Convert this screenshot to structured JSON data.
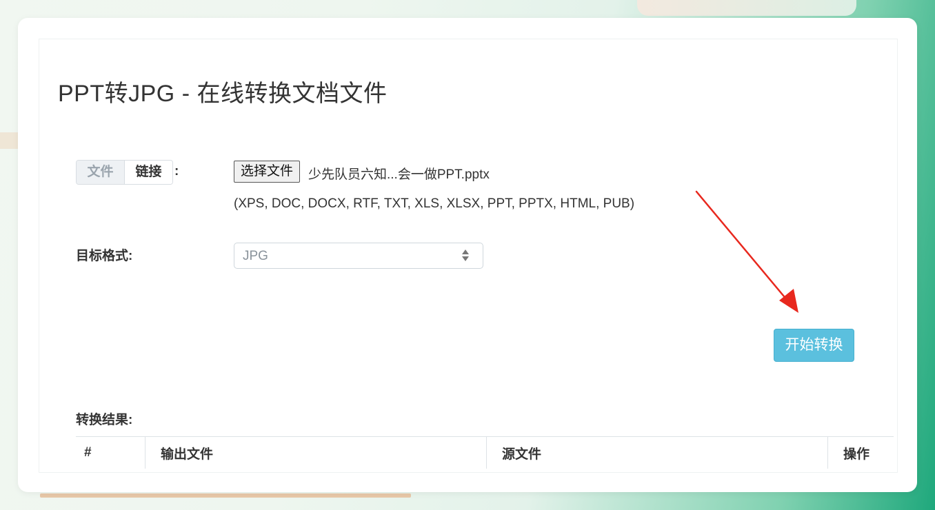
{
  "page": {
    "title": "PPT转JPG - 在线转换文档文件"
  },
  "source": {
    "tabs": [
      {
        "label": "文件",
        "active": true
      },
      {
        "label": "链接",
        "active": false
      }
    ],
    "colon": ":",
    "choose_button_label": "选择文件",
    "chosen_file": "少先队员六知...会一做PPT.pptx",
    "supported_formats": "(XPS, DOC, DOCX, RTF, TXT, XLS, XLSX, PPT, PPTX, HTML, PUB)"
  },
  "target": {
    "label": "目标格式:",
    "selected": "JPG"
  },
  "actions": {
    "start_label": "开始转换"
  },
  "results": {
    "label": "转换结果:",
    "columns": [
      "#",
      "输出文件",
      "源文件",
      "操作"
    ]
  },
  "colors": {
    "start_button": "#5bc0de",
    "annotation_arrow": "#e8281e"
  },
  "icons": {
    "select_caret": "select-updown-icon",
    "annotation": "red-arrow-icon"
  }
}
